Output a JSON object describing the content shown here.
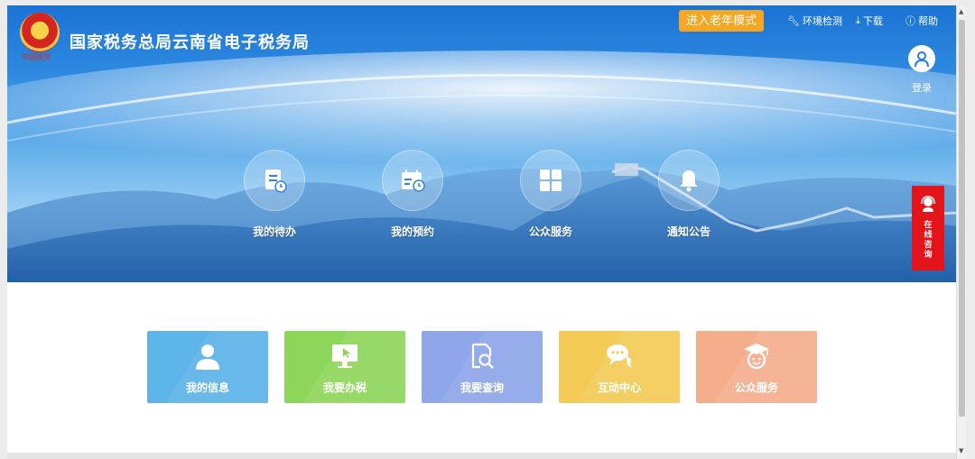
{
  "header": {
    "title": "国家税务总局云南省电子税务局",
    "logo_caption": "中国税务",
    "elder_mode_button": "进入老年模式",
    "links": [
      {
        "label": "环境检测",
        "icon": "wrench-icon"
      },
      {
        "label": "下载",
        "icon": "download-icon"
      },
      {
        "label": "帮助",
        "icon": "help-icon"
      }
    ],
    "login_label": "登录"
  },
  "hero": {
    "items": [
      {
        "label": "我的待办",
        "icon": "document-clock-icon"
      },
      {
        "label": "我的预约",
        "icon": "calendar-clock-icon"
      },
      {
        "label": "公众服务",
        "icon": "grid-icon"
      },
      {
        "label": "通知公告",
        "icon": "bell-icon"
      }
    ]
  },
  "consult": {
    "label": "在线咨询",
    "icon": "headset-icon"
  },
  "tiles": [
    {
      "label": "我的信息",
      "icon": "user-icon",
      "color": "#5cb4e8"
    },
    {
      "label": "我要办税",
      "icon": "monitor-cursor-icon",
      "color": "#8ed65a"
    },
    {
      "label": "我要查询",
      "icon": "document-search-icon",
      "color": "#8fa7ea"
    },
    {
      "label": "互动中心",
      "icon": "chat-bubbles-icon",
      "color": "#f2ca55"
    },
    {
      "label": "公众服务",
      "icon": "graduate-icon",
      "color": "#f5ae8c"
    }
  ],
  "colors": {
    "accent_orange": "#f5a623",
    "consult_red": "#e3151b",
    "banner_blue": "#1b73d4"
  }
}
